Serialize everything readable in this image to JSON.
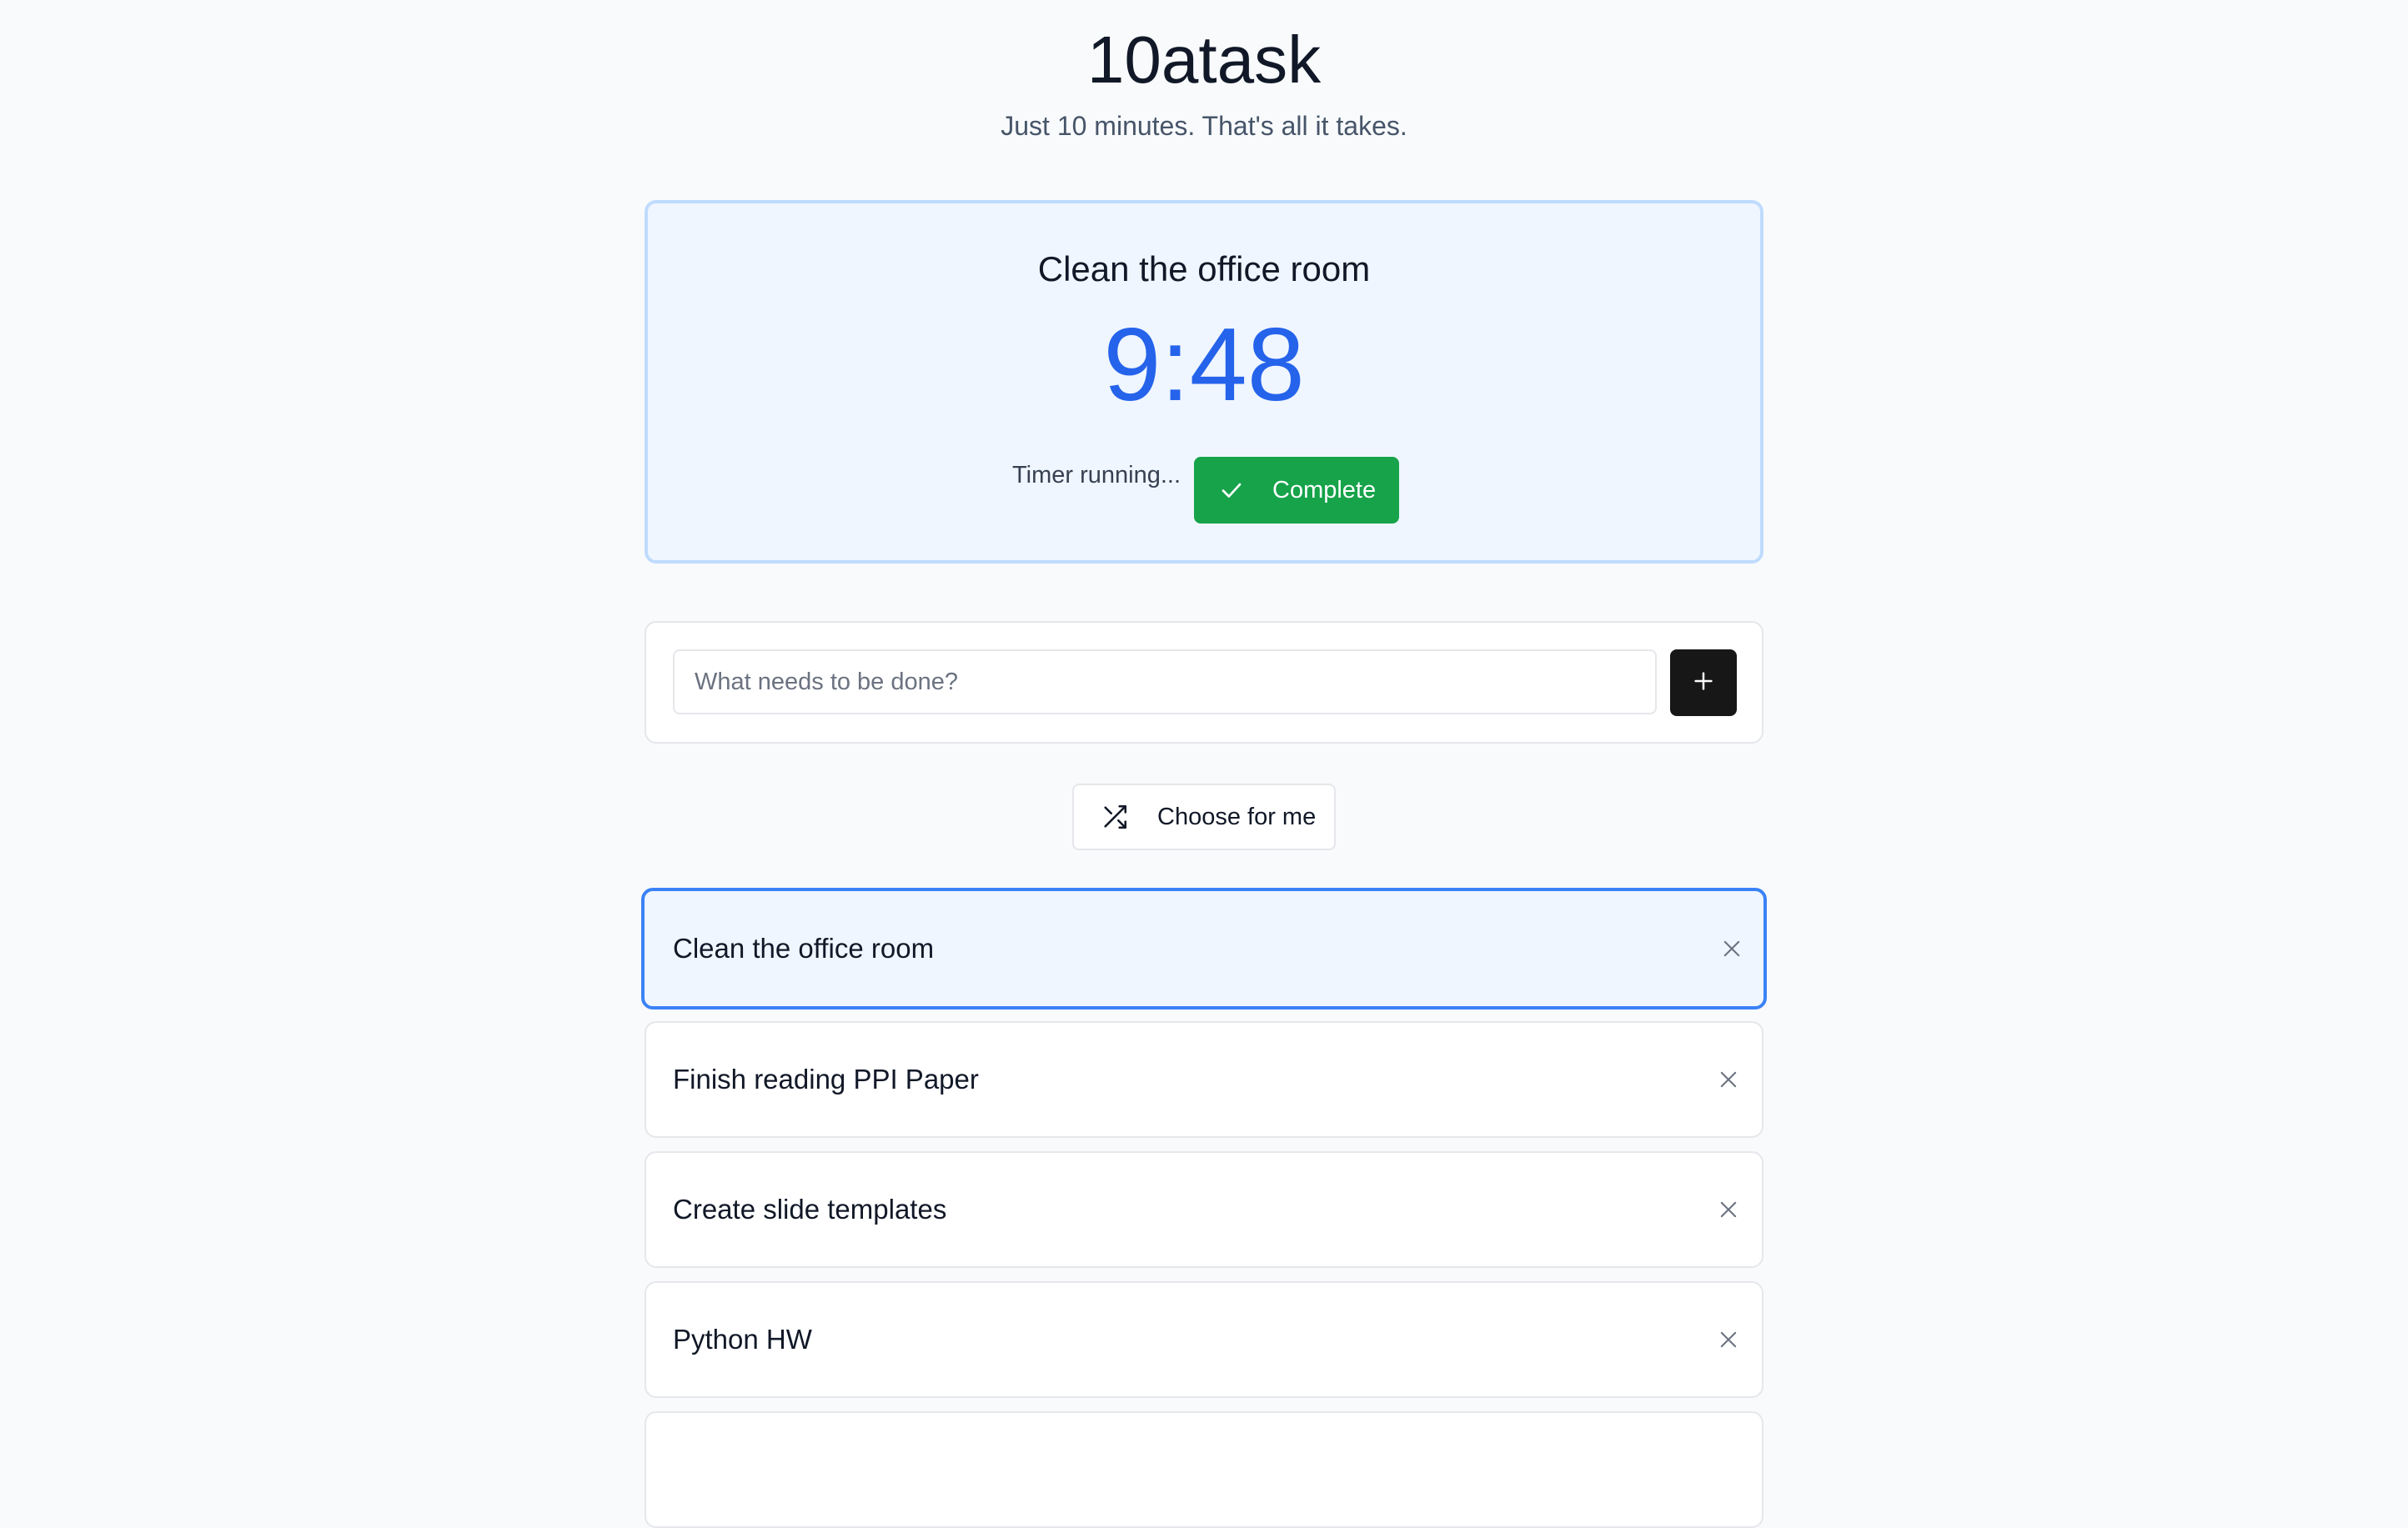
{
  "app": {
    "title": "10atask",
    "subtitle": "Just 10 minutes. That's all it takes."
  },
  "timer": {
    "task": "Clean the office room",
    "time": "9:48",
    "status": "Timer running...",
    "complete_label": "Complete",
    "complete_icon": "check-icon",
    "accent_color": "#2563eb",
    "complete_color": "#16a34a"
  },
  "input": {
    "placeholder": "What needs to be done?",
    "value": "",
    "add_icon": "plus-icon"
  },
  "choose": {
    "label": "Choose for me",
    "icon": "shuffle-icon"
  },
  "tasks": [
    {
      "label": "Clean the office room",
      "active": true
    },
    {
      "label": "Finish reading PPI Paper",
      "active": false
    },
    {
      "label": "Create slide templates",
      "active": false
    },
    {
      "label": "Python HW",
      "active": false
    },
    {
      "label": "",
      "active": false
    }
  ]
}
